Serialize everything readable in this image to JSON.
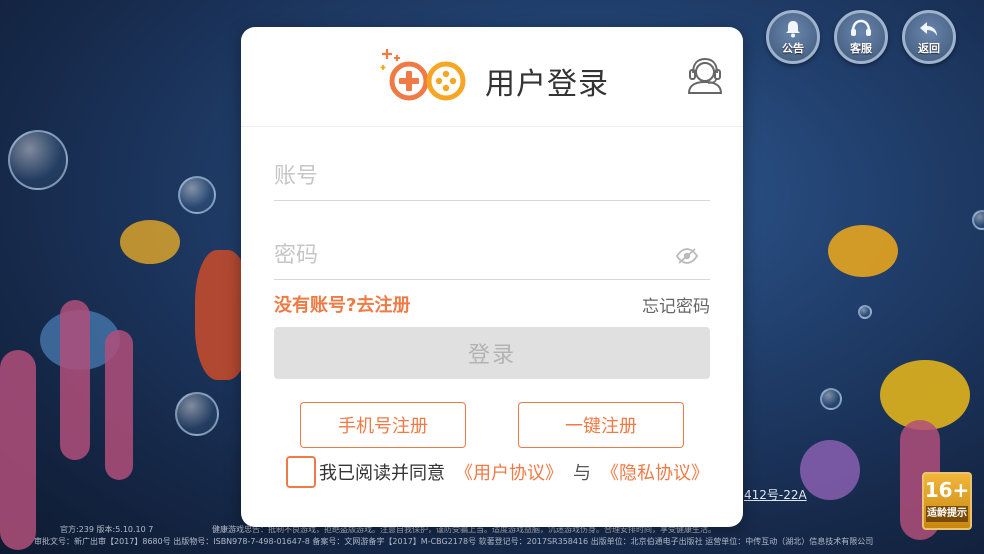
{
  "top_buttons": [
    {
      "icon": "notice-icon",
      "label": "公告"
    },
    {
      "icon": "customer-service-icon",
      "label": "客服"
    },
    {
      "icon": "back-arrow-icon",
      "label": "返回"
    }
  ],
  "login": {
    "title": "用户登录",
    "account_placeholder": "账号",
    "password_placeholder": "密码",
    "register_link": "没有账号?去注册",
    "forgot_link": "忘记密码",
    "login_button": "登录",
    "phone_register_button": "手机号注册",
    "onekey_register_button": "一键注册",
    "agree_text": "我已阅读并同意",
    "user_agreement": "《用户协议》",
    "and_text": "与",
    "privacy_agreement": "《隐私协议》"
  },
  "footer": {
    "line1_left": "官方:239 版本:5.10.10 7",
    "line1_right": "健康游戏忠告：抵制不良游戏，拒绝盗版游戏。注意自我保护，谨防受骗上当。适度游戏益脑，沉迷游戏伤身。合理安排时间，享受健康生活。",
    "line2": "审批文号：新广出审【2017】8680号 出版物号：ISBN978-7-498-01647-8 备案号：文网游备字【2017】M-CBG2178号 软著登记号：2017SR358416 出版单位：北京伯通电子出版社 运营单位：中传互动（湖北）信息技术有限公司",
    "reg_code": "412号-22A"
  },
  "age_badge": {
    "age": "16+",
    "tip": "适龄提示"
  },
  "colors": {
    "accent": "#f07a45",
    "login_disabled_bg": "#e0e0e0",
    "card_bg": "#ffffff"
  }
}
